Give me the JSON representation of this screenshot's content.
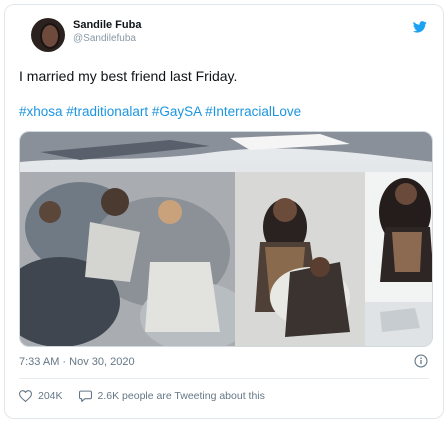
{
  "tweet": {
    "author_name": "Sandile Fuba",
    "author_handle": "@Sandilefuba",
    "text": "I married my best friend last Friday.",
    "hashtags": "#xhosa #traditionalart #GaySA #InterracialLove",
    "timestamp": "7:33 AM · Nov 30, 2020",
    "likes": "204K",
    "conversation": "2.6K people are Tweeting about this"
  },
  "colors": {
    "link": "#1b95e0",
    "muted": "#657786",
    "brand": "#1da1f2"
  },
  "icons": {
    "brand": "twitter-bird-icon",
    "info": "info-icon",
    "like": "heart-icon",
    "reply": "comment-icon"
  }
}
